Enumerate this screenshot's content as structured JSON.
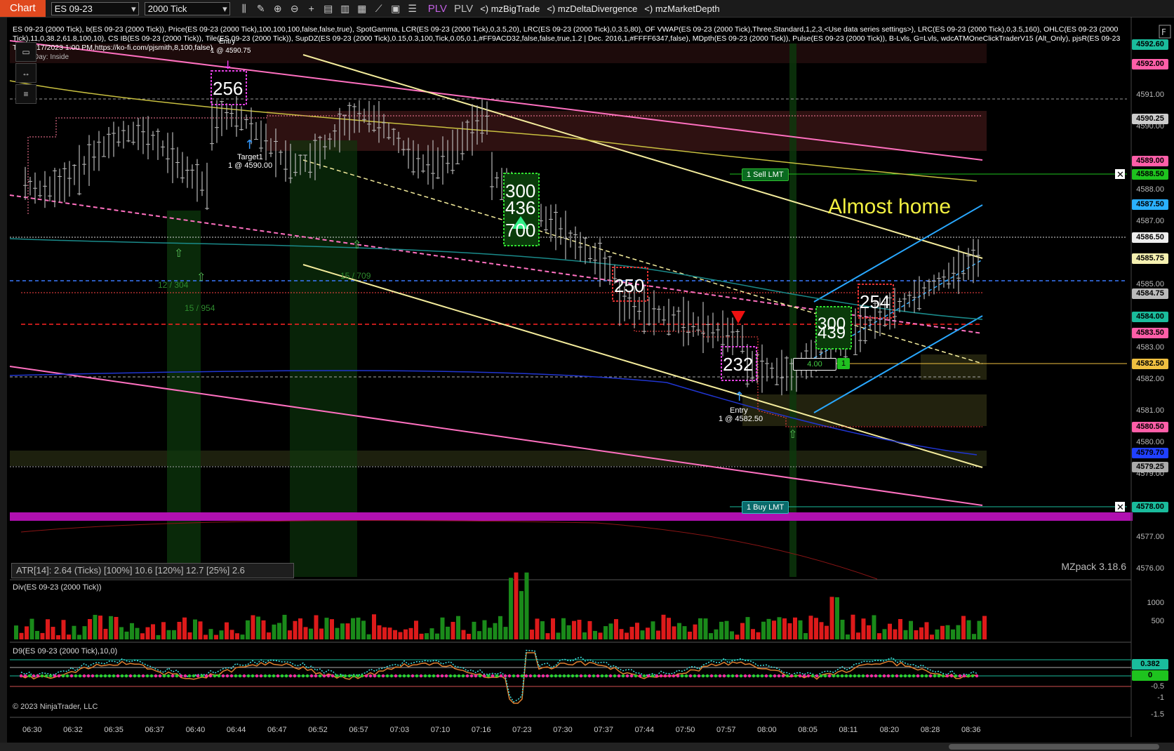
{
  "toolbar": {
    "tab": "Chart",
    "instrument": "ES 09-23",
    "interval": "2000 Tick",
    "plv1": "PLV",
    "plv2": "PLV",
    "ind1": "<) mzBigTrade",
    "ind2": "<) mzDeltaDivergence",
    "ind3": "<) mzMarketDepth"
  },
  "legend": {
    "line1": "ES 09-23 (2000 Tick), b(ES 09-23 (2000 Tick)), Price(ES 09-23 (2000 Tick),100,100,100,false,false,true), SpotGamma, LCR(ES 09-23 (2000 Tick),0,3.5,20), LRC(ES 09-23 (2000 Tick),0,3.5,80), OF VWAP(ES 09-23 (2000 Tick),Three,Standard,1,2,3,<Use data series settings>), LRC(ES 09-23 (2000 Tick),0,3.5,160), OHLC(ES 09-23 (2000",
    "line2": "Tick),11,0,38.2,61.8,100,10), CS IB(ES 09-23 (2000 Tick)), Tile(ES 09-23 (2000 Tick)), SupDZ(ES 09-23 (2000 Tick),0.15,0.3,100,Tick,0.05,0.1,#FF9ACD32,false,false,true,1.2 | Dec. 2016,1,#FFFF6347,false), MDpth(ES 09-23 (2000 Tick)), Pulse(ES 09-23 (2000 Tick)), B-Lvls, G=Lvls, wdcATMOneClickTraderV15 (Alt_Only), pjsR(ES 09-23",
    "line3": "Tick),6/17/2023 1:00 PM,https://ko-fi.com/pjsmith,8,100,false)",
    "day": "Day: Inside"
  },
  "side_icons": [
    "ruler-icon",
    "arrows-icon",
    "menu-icon"
  ],
  "price_badges": [
    {
      "v": "4592.60",
      "c": "#1abc9c",
      "y": 63
    },
    {
      "v": "4592.00",
      "c": "#ff5ea8",
      "y": 91
    },
    {
      "v": "4590.25",
      "c": "#cccccc",
      "y": 169
    },
    {
      "v": "4589.00",
      "c": "#ff5ea8",
      "y": 229
    },
    {
      "v": "4588.50",
      "c": "#1ec31e",
      "y": 248
    },
    {
      "v": "4587.50",
      "c": "#2ab0ff",
      "y": 291
    },
    {
      "v": "4586.50",
      "c": "#eeeeee",
      "y": 338
    },
    {
      "v": "4585.75",
      "c": "#f5f0b0",
      "y": 368
    },
    {
      "v": "4584.75",
      "c": "#bbbbbb",
      "y": 418
    },
    {
      "v": "4584.00",
      "c": "#1abc9c",
      "y": 451
    },
    {
      "v": "4583.50",
      "c": "#ff5ea8",
      "y": 474
    },
    {
      "v": "4582.50",
      "c": "#f0c040",
      "y": 518
    },
    {
      "v": "4580.50",
      "c": "#ff5ea8",
      "y": 608
    },
    {
      "v": "4579.70",
      "c": "#2040ff",
      "y": 645
    },
    {
      "v": "4579.25",
      "c": "#aaaaaa",
      "y": 665
    },
    {
      "v": "4578.00",
      "c": "#1abc9c",
      "y": 722
    }
  ],
  "axis_labels": [
    {
      "v": "4591.00",
      "y": 136
    },
    {
      "v": "4590.00",
      "y": 181
    },
    {
      "v": "4588.00",
      "y": 271
    },
    {
      "v": "4587.00",
      "y": 316
    },
    {
      "v": "4585.00",
      "y": 406
    },
    {
      "v": "4583.00",
      "y": 496
    },
    {
      "v": "4582.00",
      "y": 541
    },
    {
      "v": "4581.00",
      "y": 586
    },
    {
      "v": "4580.00",
      "y": 631
    },
    {
      "v": "4579.00",
      "y": 676
    },
    {
      "v": "4577.00",
      "y": 766
    },
    {
      "v": "4576.00",
      "y": 811
    }
  ],
  "time_labels": [
    "06:30",
    "06:32",
    "06:35",
    "06:37",
    "06:40",
    "06:44",
    "06:47",
    "06:52",
    "06:57",
    "07:03",
    "07:10",
    "07:16",
    "07:23",
    "07:30",
    "07:37",
    "07:44",
    "07:50",
    "07:57",
    "08:00",
    "08:05",
    "08:11",
    "08:20",
    "08:28",
    "08:36"
  ],
  "annotations": {
    "almost_home": "Almost home",
    "n256": "256",
    "n300a": "300",
    "n436": "436",
    "n700": "700",
    "n250": "250",
    "n232": "232",
    "n254": "254",
    "n300b": "300",
    "n439": "439",
    "target": "Target1",
    "target2": "1 @ 4590.00",
    "entry": "Entry",
    "entry2": "1 @ 4582.50",
    "entry_top": "Entry",
    "entry_top2": "1 @ 4590.75",
    "vol1": "12 / 304",
    "vol2": "15 / 954",
    "vol3": "15 / 709"
  },
  "orders": {
    "sell": "1  Sell LMT",
    "buy": "1  Buy LMT",
    "pos_qty": "4.00",
    "pos_n": "1"
  },
  "atr": "ATR[14]: 2.64 (Ticks) [100%] 10.6  [120%] 12.7  [25%] 2.6",
  "mzpack": "MZpack 3.18.6",
  "div_panel": {
    "title": "Div(ES 09-23 (2000 Tick))",
    "l1000": "1000",
    "l500": "500"
  },
  "d9_panel": {
    "title": "D9(ES 09-23 (2000 Tick),10,0)",
    "b1": "0.382",
    "b2": "0",
    "l1": "-0.5",
    "l2": "-1",
    "l3": "-1.5"
  },
  "copyright": "© 2023 NinjaTrader, LLC",
  "chart_data": {
    "type": "bar",
    "title": "",
    "series": [
      {
        "name": "ES 09-23 (2000 Tick)"
      }
    ],
    "ylim": [
      4575.5,
      4593
    ],
    "x_ticks": [
      "06:30",
      "06:32",
      "06:35",
      "06:37",
      "06:40",
      "06:44",
      "06:47",
      "06:52",
      "06:57",
      "07:03",
      "07:10",
      "07:16",
      "07:23",
      "07:30",
      "07:37",
      "07:44",
      "07:50",
      "07:57",
      "08:00",
      "08:05",
      "08:11",
      "08:20",
      "08:28",
      "08:36"
    ]
  }
}
